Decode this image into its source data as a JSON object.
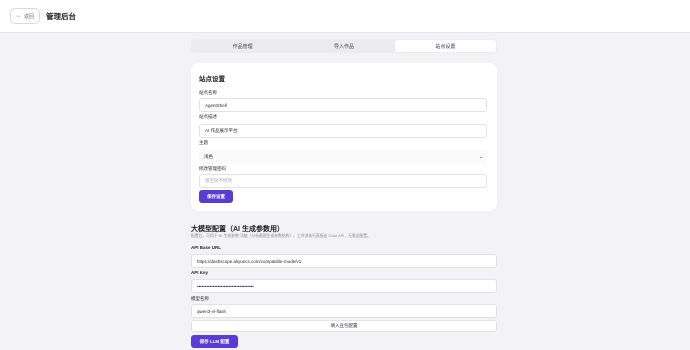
{
  "header": {
    "back_label": "返回",
    "title": "管理后台"
  },
  "tabs": [
    {
      "label": "作品管理",
      "active": false
    },
    {
      "label": "导入作品",
      "active": false
    },
    {
      "label": "站点设置",
      "active": true
    }
  ],
  "site_settings": {
    "title": "站点设置",
    "site_name_label": "站点名称",
    "site_name_value": "AgentShell",
    "site_desc_label": "站点描述",
    "site_desc_value": "AI 作品展示平台",
    "theme_label": "主题",
    "theme_value": "浅色",
    "password_label": "修改管理密码",
    "password_placeholder": "留空则不修改",
    "save_label": "保存设置"
  },
  "llm_config": {
    "title": "大模型配置（AI 生成参数用）",
    "description": "配置后，可用于\"AI 生成参数\"功能（分析截图生成参数结构）。工作流执行直接走 Coze API，无需此配置。",
    "base_url_label": "API Base URL",
    "base_url_value": "https://dashscope.aliyuncs.com/compatible-mode/v1",
    "api_key_label": "API Key",
    "api_key_value": "••••••••••••••••••••••••••••••••••••",
    "model_label": "模型名称",
    "model_value": "qwen3-vl-flash",
    "fill_preset_label": "填入豆包配置",
    "save_label": "保存 LLM 配置"
  },
  "colors": {
    "accent": "#5b3bd6",
    "background": "#f3f3f5"
  }
}
